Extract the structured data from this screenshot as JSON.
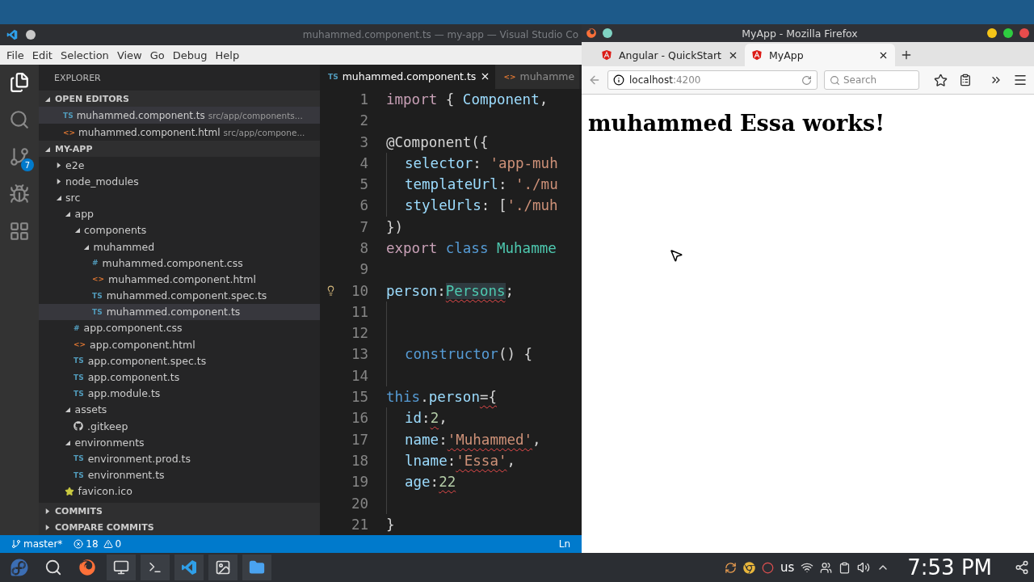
{
  "vscode": {
    "title": "muhammed.component.ts — my-app — Visual Studio Co",
    "menu": [
      "File",
      "Edit",
      "Selection",
      "View",
      "Go",
      "Debug",
      "Help"
    ],
    "activity_bar": [
      {
        "kind": "files",
        "selected": true
      },
      {
        "kind": "search",
        "selected": false
      },
      {
        "kind": "source-control",
        "selected": false,
        "badge": "7"
      },
      {
        "kind": "debug",
        "selected": false
      },
      {
        "kind": "extensions",
        "selected": false
      }
    ],
    "sidebar": {
      "title": "EXPLORER",
      "open_editors": {
        "title": "OPEN EDITORS",
        "expanded": true,
        "items": [
          {
            "icon_text": "TS",
            "color": "#519aba",
            "name": "muhammed.component.ts",
            "path": "src/app/components...",
            "selected": true
          },
          {
            "icon_text": "<>",
            "color": "#e37933",
            "name": "muhammed.component.html",
            "path": "src/app/compone...",
            "selected": false
          }
        ]
      },
      "project": {
        "title": "MY-APP",
        "expanded": true,
        "items": [
          {
            "name": "e2e",
            "kind": "folder",
            "expanded": false,
            "selected": false
          },
          {
            "name": "node_modules",
            "kind": "folder",
            "expanded": false,
            "selected": false
          },
          {
            "name": "src",
            "kind": "folder",
            "expanded": true,
            "selected": false,
            "children": [
              {
                "name": "app",
                "kind": "folder",
                "expanded": true,
                "selected": false,
                "children": [
                  {
                    "name": "components",
                    "kind": "folder",
                    "expanded": true,
                    "selected": false,
                    "children": [
                      {
                        "name": "muhammed",
                        "kind": "folder",
                        "expanded": true,
                        "selected": false,
                        "children": [
                          {
                            "name": "muhammed.component.css",
                            "kind": "file",
                            "icon_text": "#",
                            "color": "#519aba",
                            "selected": false
                          },
                          {
                            "name": "muhammed.component.html",
                            "kind": "file",
                            "icon_text": "<>",
                            "color": "#e37933",
                            "selected": false
                          },
                          {
                            "name": "muhammed.component.spec.ts",
                            "kind": "file",
                            "icon_text": "TS",
                            "color": "#519aba",
                            "selected": false
                          },
                          {
                            "name": "muhammed.component.ts",
                            "kind": "file",
                            "icon_text": "TS",
                            "color": "#519aba",
                            "selected": true
                          }
                        ]
                      }
                    ]
                  },
                  {
                    "name": "app.component.css",
                    "kind": "file",
                    "icon_text": "#",
                    "color": "#519aba",
                    "selected": false
                  },
                  {
                    "name": "app.component.html",
                    "kind": "file",
                    "icon_text": "<>",
                    "color": "#e37933",
                    "selected": false
                  },
                  {
                    "name": "app.component.spec.ts",
                    "kind": "file",
                    "icon_text": "TS",
                    "color": "#519aba",
                    "selected": false
                  },
                  {
                    "name": "app.component.ts",
                    "kind": "file",
                    "icon_text": "TS",
                    "color": "#519aba",
                    "selected": false
                  },
                  {
                    "name": "app.module.ts",
                    "kind": "file",
                    "icon_text": "TS",
                    "color": "#519aba",
                    "selected": false
                  }
                ]
              },
              {
                "name": "assets",
                "kind": "folder",
                "expanded": true,
                "selected": false,
                "children": [
                  {
                    "name": ".gitkeep",
                    "kind": "git",
                    "selected": false
                  }
                ]
              },
              {
                "name": "environments",
                "kind": "folder",
                "expanded": true,
                "selected": false,
                "children": [
                  {
                    "name": "environment.prod.ts",
                    "kind": "file",
                    "icon_text": "TS",
                    "color": "#519aba",
                    "selected": false
                  },
                  {
                    "name": "environment.ts",
                    "kind": "file",
                    "icon_text": "TS",
                    "color": "#519aba",
                    "selected": false
                  }
                ]
              },
              {
                "name": "favicon.ico",
                "kind": "favicon",
                "selected": false
              }
            ]
          }
        ]
      },
      "bottom_sections": [
        {
          "title": "COMMITS",
          "expanded": false
        },
        {
          "title": "COMPARE COMMITS",
          "expanded": false
        }
      ]
    },
    "editor_tabs": [
      {
        "icon_text": "TS",
        "color": "#519aba",
        "label": "muhammed.component.ts",
        "selected": true
      },
      {
        "icon_text": "<>",
        "color": "#e37933",
        "label": "muhamme",
        "selected": false
      }
    ],
    "code": [
      {
        "number": "1",
        "indented": false,
        "tokens": [
          {
            "text": "import ",
            "kind": "keyword"
          },
          {
            "text": "{ ",
            "kind": "plain"
          },
          {
            "text": "Component",
            "kind": "variable"
          },
          {
            "text": ",",
            "kind": "plain"
          }
        ]
      },
      {
        "number": "2",
        "indented": false
      },
      {
        "number": "3",
        "indented": false,
        "tokens": [
          {
            "text": "@Component({",
            "kind": "plain"
          }
        ]
      },
      {
        "number": "4",
        "indented": true,
        "tokens": [
          {
            "text": "selector",
            "kind": "variable"
          },
          {
            "text": ": ",
            "kind": "plain"
          },
          {
            "text": "'app-muh",
            "kind": "string"
          }
        ]
      },
      {
        "number": "5",
        "indented": true,
        "tokens": [
          {
            "text": "templateUrl",
            "kind": "variable"
          },
          {
            "text": ": ",
            "kind": "plain"
          },
          {
            "text": "'./mu",
            "kind": "string"
          }
        ]
      },
      {
        "number": "6",
        "indented": true,
        "tokens": [
          {
            "text": "styleUrls",
            "kind": "variable"
          },
          {
            "text": ": [",
            "kind": "plain"
          },
          {
            "text": "'./muh",
            "kind": "string"
          }
        ]
      },
      {
        "number": "7",
        "indented": false,
        "tokens": [
          {
            "text": "})",
            "kind": "plain"
          }
        ]
      },
      {
        "number": "8",
        "indented": false,
        "tokens": [
          {
            "text": "export ",
            "kind": "keyword"
          },
          {
            "text": "class ",
            "kind": "storage"
          },
          {
            "text": "Muhamme",
            "kind": "type"
          }
        ]
      },
      {
        "number": "9",
        "indented": false
      },
      {
        "number": "10",
        "indented": false,
        "lightbulb": true,
        "tokens": [
          {
            "text": "person",
            "kind": "variable"
          },
          {
            "text": ":",
            "kind": "plain"
          },
          {
            "text": "Persons",
            "kind": "type",
            "highlighted": true,
            "error": true
          },
          {
            "text": ";",
            "kind": "plain"
          }
        ]
      },
      {
        "number": "11",
        "indented": true
      },
      {
        "number": "12",
        "indented": true
      },
      {
        "number": "13",
        "indented": true,
        "tokens": [
          {
            "text": "constructor",
            "kind": "storage"
          },
          {
            "text": "() {",
            "kind": "plain"
          }
        ]
      },
      {
        "number": "14",
        "indented": true
      },
      {
        "number": "15",
        "indented": false,
        "tokens": [
          {
            "text": "this",
            "kind": "storage"
          },
          {
            "text": ".",
            "kind": "plain"
          },
          {
            "text": "person",
            "kind": "variable"
          },
          {
            "text": "={",
            "kind": "plain",
            "error": true
          }
        ]
      },
      {
        "number": "16",
        "indented": true,
        "tokens": [
          {
            "text": "id",
            "kind": "variable"
          },
          {
            "text": ":",
            "kind": "plain"
          },
          {
            "text": "2",
            "kind": "number",
            "error": true
          },
          {
            "text": ",",
            "kind": "plain"
          }
        ]
      },
      {
        "number": "17",
        "indented": true,
        "tokens": [
          {
            "text": "name",
            "kind": "variable"
          },
          {
            "text": ":",
            "kind": "plain"
          },
          {
            "text": "'Muhammed'",
            "kind": "string",
            "error": true
          },
          {
            "text": ",",
            "kind": "plain"
          }
        ]
      },
      {
        "number": "18",
        "indented": true,
        "tokens": [
          {
            "text": "lname",
            "kind": "variable"
          },
          {
            "text": ":",
            "kind": "plain"
          },
          {
            "text": "'Essa'",
            "kind": "string",
            "error": true
          },
          {
            "text": ",",
            "kind": "plain"
          }
        ]
      },
      {
        "number": "19",
        "indented": true,
        "tokens": [
          {
            "text": "age",
            "kind": "variable"
          },
          {
            "text": ":",
            "kind": "plain"
          },
          {
            "text": "22",
            "kind": "number",
            "error": true
          }
        ]
      },
      {
        "number": "20",
        "indented": true
      },
      {
        "number": "21",
        "indented": false,
        "tokens": [
          {
            "text": "}",
            "kind": "plain"
          }
        ]
      }
    ],
    "status_bar": {
      "branch": "master*",
      "errors": "18",
      "warnings": "0",
      "position": "Ln"
    }
  },
  "firefox": {
    "title": "MyApp - Mozilla Firefox",
    "tabs": [
      {
        "label": "Angular - QuickStart",
        "selected": false
      },
      {
        "label": "MyApp",
        "selected": true
      }
    ],
    "url": {
      "host": "localhost",
      "port": ":4200"
    },
    "search": {
      "placeholder": "Search"
    },
    "page_heading": "muhammed Essa works!"
  },
  "taskbar": {
    "apps": [
      {
        "kind": "search"
      },
      {
        "kind": "firefox"
      },
      {
        "kind": "screen"
      },
      {
        "kind": "terminal"
      },
      {
        "kind": "vscode"
      },
      {
        "kind": "image"
      },
      {
        "kind": "files"
      }
    ],
    "tray": [
      {
        "kind": "updates"
      },
      {
        "kind": "chrome"
      },
      {
        "kind": "record"
      },
      {
        "kind": "text",
        "text": "us"
      },
      {
        "kind": "wifi"
      },
      {
        "kind": "user"
      },
      {
        "kind": "clipboard"
      },
      {
        "kind": "volume"
      },
      {
        "kind": "expand"
      }
    ],
    "clock": "7:53 PM"
  }
}
